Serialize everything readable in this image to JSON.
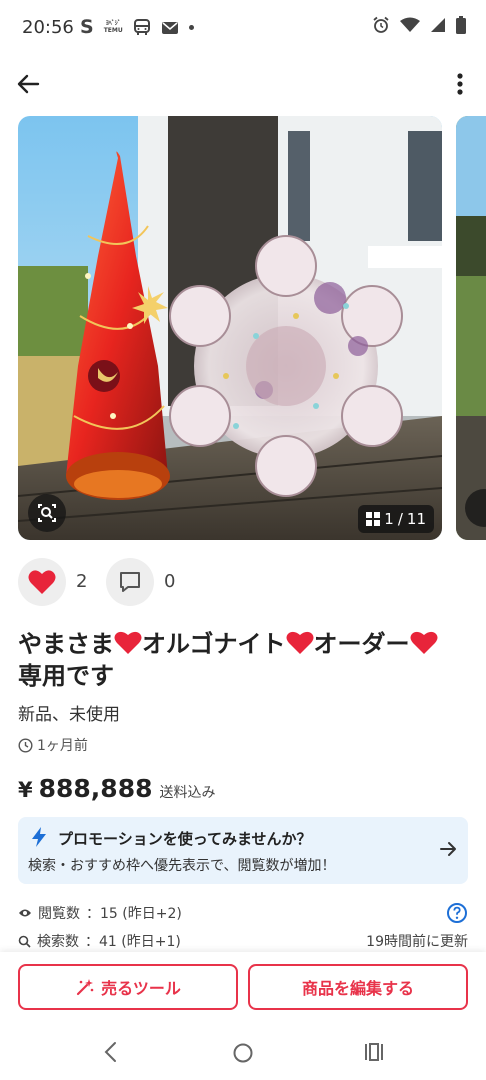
{
  "status_bar": {
    "time": "20:56",
    "left_icons": [
      "s-app-icon",
      "temu-icon",
      "bus-icon",
      "mail-icon",
      "dot-icon"
    ],
    "temu_label_top": "ﾖﾍﾞｼﾞ",
    "temu_label_bottom": "TEMU",
    "right_icons": [
      "alarm-icon",
      "wifi-icon",
      "signal-icon",
      "battery-icon"
    ]
  },
  "app_bar": {
    "back_icon": "arrow-left-icon",
    "menu_icon": "more-vertical-icon"
  },
  "gallery": {
    "photo_subject": "orgonite-tree-and-snowflake",
    "counter_current": "1",
    "counter_sep": "/",
    "counter_total": "11",
    "zoom_icon": "image-search-icon"
  },
  "reactions": {
    "likes": "2",
    "comments": "0"
  },
  "item": {
    "title_part1": "やまさま",
    "title_part2": "オルゴナイト",
    "title_part3": "オーダー",
    "title_line2": "専用です",
    "condition": "新品、未使用",
    "posted": "1ヶ月前"
  },
  "price": {
    "currency": "¥",
    "value": "888,888",
    "note": "送料込み"
  },
  "promo": {
    "title": "プロモーションを使ってみませんか？",
    "description": "検索・おすすめ枠へ優先表示で、閲覧数が増加！"
  },
  "stats": {
    "views_label": "閲覧数",
    "views_value": "：15 (昨日+2)",
    "search_label": "検索数",
    "search_value": "：41 (昨日+1)",
    "updated": "19時間前に更新"
  },
  "actions": {
    "sell_tool": "売るツール",
    "edit_item": "商品を編集する"
  },
  "nav": {
    "back": "nav-back-icon",
    "home": "nav-home-icon",
    "recents": "nav-recents-icon"
  },
  "colors": {
    "accent": "#e8334a",
    "heart": "#e8243a",
    "promo_bg": "#e9f3fc",
    "promo_icon": "#1d6fd6"
  }
}
